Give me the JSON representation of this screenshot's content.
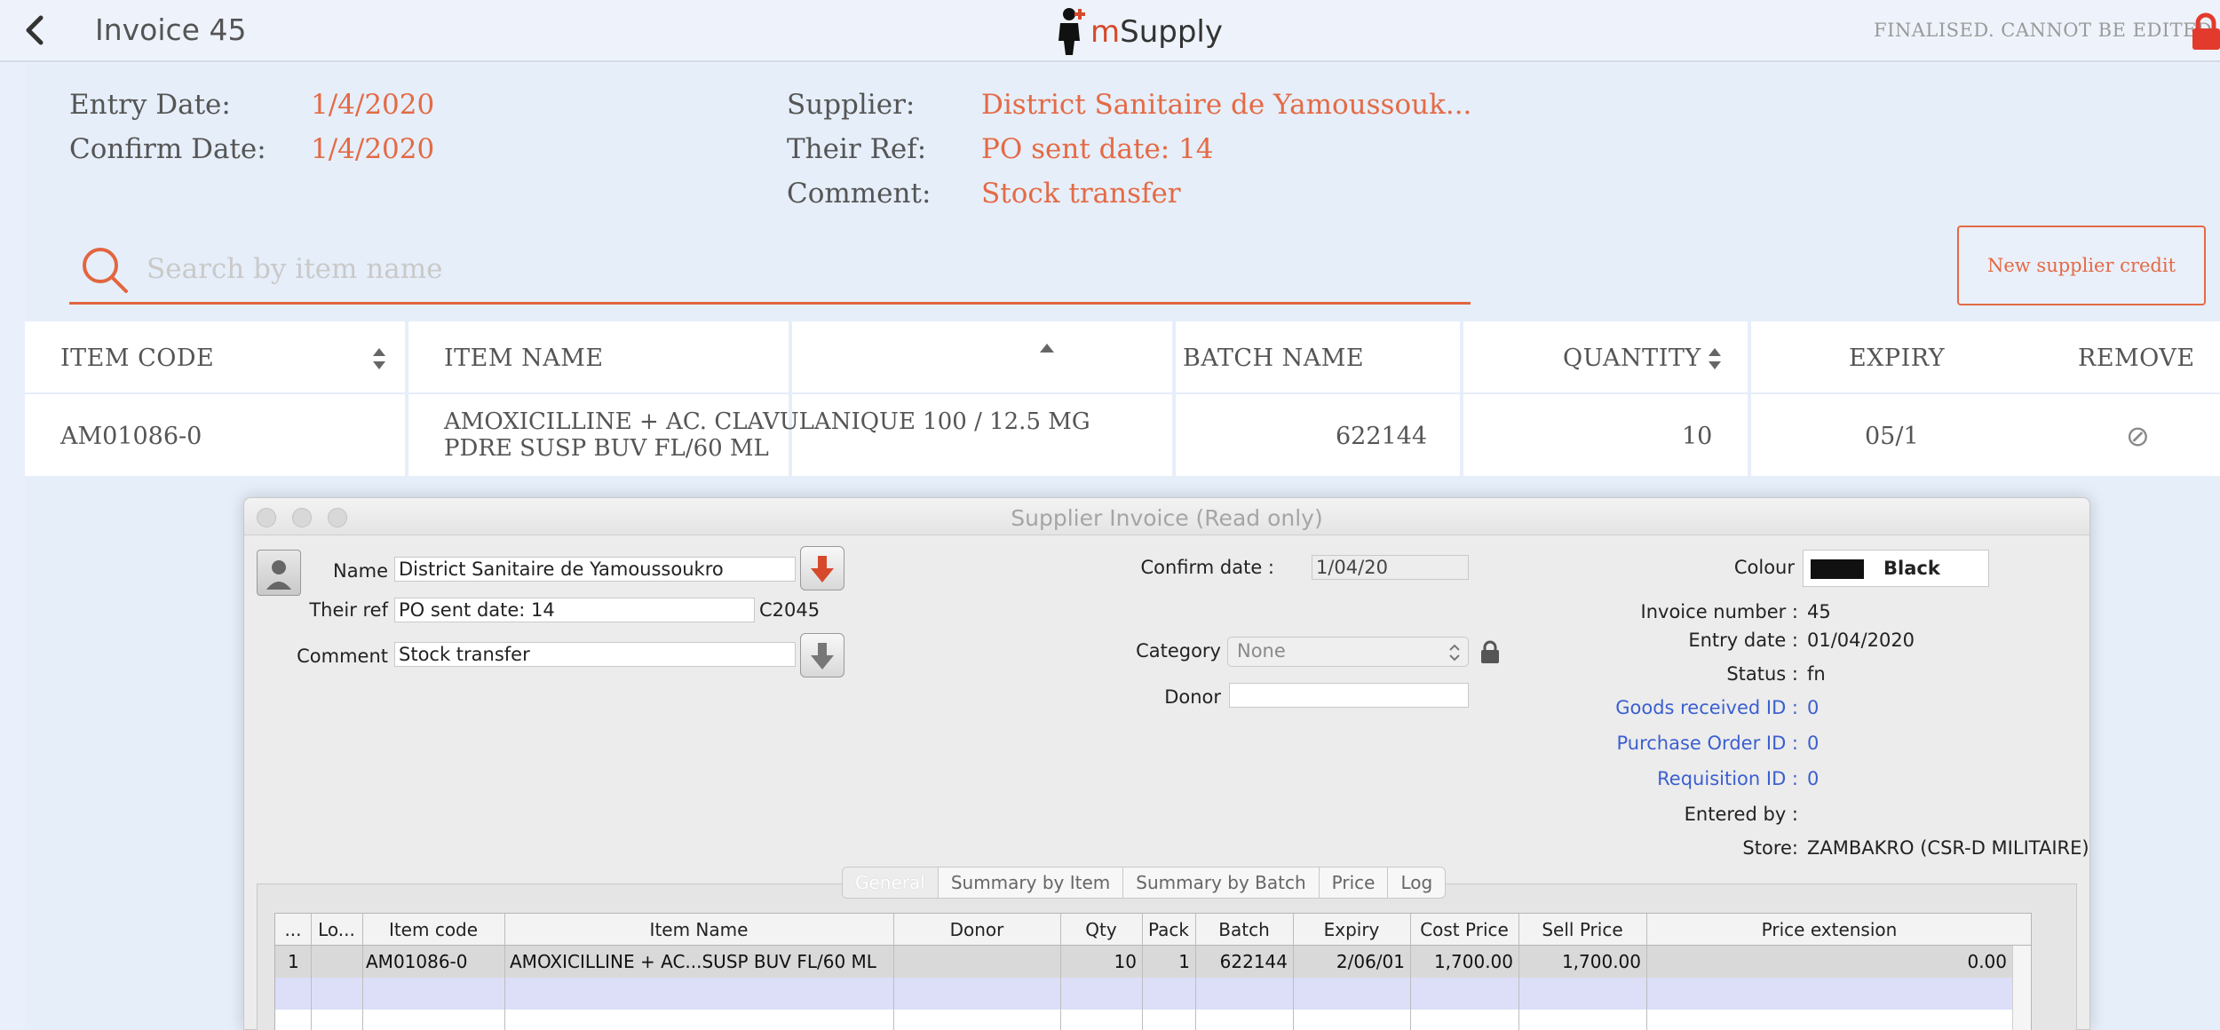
{
  "topbar": {
    "title": "Invoice 45",
    "logo_m": "m",
    "logo_rest": "Supply",
    "status_text": "FINALISED. CANNOT BE EDITED"
  },
  "header": {
    "entry_date_label": "Entry Date:",
    "entry_date": "1/4/2020",
    "confirm_date_label": "Confirm Date:",
    "confirm_date": "1/4/2020",
    "supplier_label": "Supplier:",
    "supplier": "District Sanitaire de Yamoussouk...",
    "their_ref_label": "Their Ref:",
    "their_ref": "PO sent date: 14",
    "comment_label": "Comment:",
    "comment": "Stock transfer"
  },
  "search": {
    "placeholder": "Search by item name"
  },
  "new_supplier_credit": "New supplier credit",
  "table": {
    "columns": [
      "ITEM CODE",
      "ITEM NAME",
      "BATCH NAME",
      "QUANTITY",
      "EXPIRY",
      "REMOVE"
    ],
    "rows": [
      {
        "item_code": "AM01086-0",
        "item_name_line1": "AMOXICILLINE + AC. CLAVULANIQUE 100 / 12.5 MG",
        "item_name_line2": "PDRE SUSP BUV FL/60 ML",
        "batch": "622144",
        "quantity": "10",
        "expiry": "05/1",
        "remove_icon": "⊘"
      }
    ]
  },
  "dialog": {
    "title": "Supplier Invoice (Read only)",
    "name_label": "Name",
    "name_value": "District Sanitaire de Yamoussoukro",
    "their_ref_label": "Their ref",
    "their_ref_value": "PO sent date: 14",
    "their_ref_code": "C2045",
    "comment_label": "Comment",
    "comment_value": "Stock transfer",
    "confirm_date_label": "Confirm date :",
    "confirm_date_value": "1/04/20",
    "category_label": "Category",
    "category_value": "None",
    "donor_label": "Donor",
    "donor_value": "",
    "colour_label": "Colour",
    "colour_name": "Black",
    "colour_hex": "#111111",
    "invoice_number_label": "Invoice number :",
    "invoice_number": "45",
    "entry_date_label": "Entry date :",
    "entry_date": "01/04/2020",
    "status_label": "Status :",
    "status": "fn",
    "goods_received_label": "Goods received ID :",
    "goods_received": "0",
    "purchase_order_label": "Purchase Order ID :",
    "purchase_order": "0",
    "requisition_label": "Requisition ID :",
    "requisition": "0",
    "entered_by_label": "Entered by :",
    "entered_by": "",
    "store_label": "Store:",
    "store": "ZAMBAKRO (CSR-D MILITAIRE)",
    "tabs": [
      "General",
      "Summary by Item",
      "Summary by Batch",
      "Price",
      "Log"
    ],
    "grid_columns": [
      "...",
      "Lo...",
      "Item code",
      "Item Name",
      "Donor",
      "Qty",
      "Pack",
      "Batch",
      "Expiry",
      "Cost Price",
      "Sell Price",
      "Price extension"
    ],
    "grid_rows": [
      {
        "line": "1",
        "location": "",
        "item_code": "AM01086-0",
        "item_name": "AMOXICILLINE + AC...SUSP BUV FL/60 ML",
        "donor": "",
        "qty": "10",
        "pack": "1",
        "batch": "622144",
        "expiry": "2/06/01",
        "cost_price": "1,700.00",
        "sell_price": "1,700.00",
        "price_extension": "0.00"
      }
    ]
  },
  "colors": {
    "accent": "#e46a45",
    "link_blue": "#3b5fd0",
    "background": "#e9f0fb"
  }
}
